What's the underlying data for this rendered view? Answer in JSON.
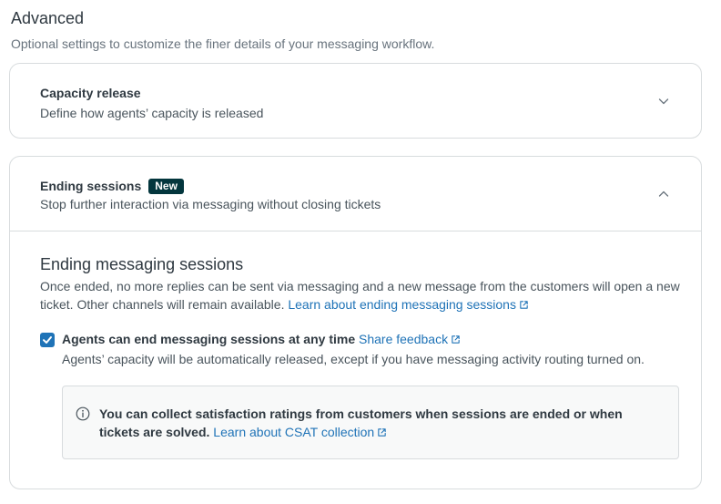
{
  "section": {
    "title": "Advanced",
    "subtitle": "Optional settings to customize the finer details of your messaging workflow."
  },
  "capacity_release": {
    "title": "Capacity release",
    "description": "Define how agents’ capacity is released",
    "expanded": false
  },
  "ending_sessions": {
    "title": "Ending sessions",
    "badge": "New",
    "description": "Stop further interaction via messaging without closing tickets",
    "expanded": true,
    "content": {
      "heading": "Ending messaging sessions",
      "body": "Once ended, no more replies can be sent via messaging and a new message from the customers will open a new ticket. Other channels will remain available. ",
      "body_link": "Learn about ending messaging sessions",
      "checkbox": {
        "label": "Agents can end messaging sessions at any time",
        "checked": true,
        "link": "Share feedback",
        "hint": "Agents’ capacity will be automatically released, except if you have messaging activity routing turned on."
      },
      "info": {
        "text": "You can collect satisfaction ratings from customers when sessions are ended or when tickets are solved.",
        "link": "Learn about CSAT collection"
      }
    }
  },
  "colors": {
    "accent": "#1f73b7",
    "badge_bg": "#03363d",
    "border": "#d8dcde",
    "text": "#2f3941",
    "muted": "#68737d"
  },
  "icons": {
    "collapsed": "chevron-down-icon",
    "expanded": "chevron-up-icon",
    "external": "external-link-icon",
    "info": "info-icon",
    "check": "check-icon"
  }
}
